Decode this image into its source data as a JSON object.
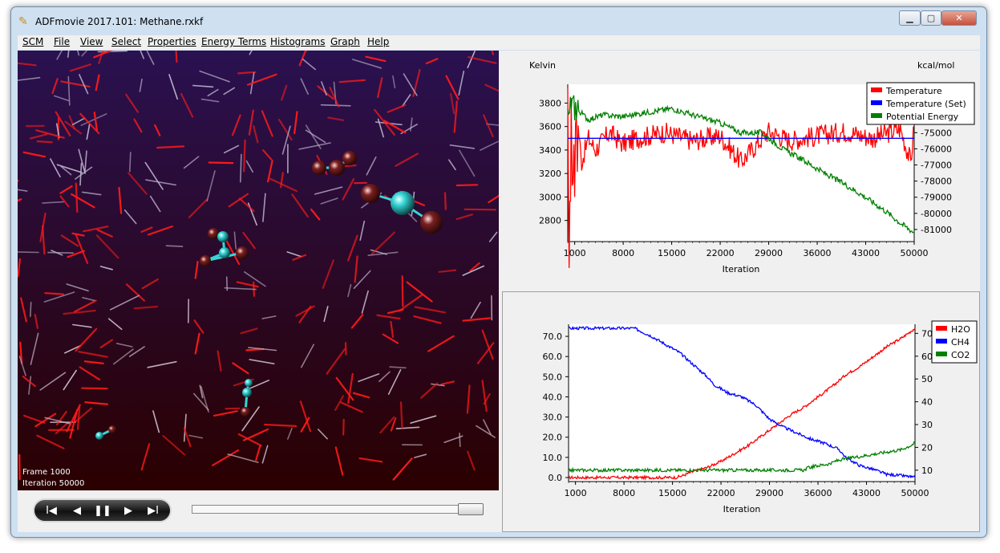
{
  "window": {
    "title": "ADFmovie 2017.101: Methane.rxkf",
    "minimize_label": "▁",
    "maximize_label": "▢",
    "close_label": "✕"
  },
  "menu": [
    "SCM",
    "File",
    "View",
    "Select",
    "Properties",
    "Energy Terms",
    "Histograms",
    "Graph",
    "Help"
  ],
  "viewer": {
    "frame_label": "Frame 1000",
    "iteration_label": "Iteration 50000",
    "playback_fraction": 0.98
  },
  "controls": {
    "first": "I◀",
    "prev": "◀",
    "pause": "❚❚",
    "next": "▶",
    "last": "▶I"
  },
  "colors": {
    "red": "#ff0000",
    "blue": "#0000ff",
    "green": "#008000",
    "viewer_top": "#2a1150",
    "viewer_bottom": "#2a0000",
    "carbon": "#35d5d5"
  },
  "chart_data": [
    {
      "type": "line",
      "left_unit": "Kelvin",
      "right_unit": "kcal/mol",
      "xlabel": "Iteration",
      "x_ticks": [
        1000,
        8000,
        15000,
        22000,
        29000,
        36000,
        43000,
        50000
      ],
      "xlim": [
        0,
        50000
      ],
      "y_left_ticks": [
        2800,
        3000,
        3200,
        3400,
        3600,
        3800
      ],
      "y_left_lim": [
        2620,
        3960
      ],
      "y_right_ticks": [
        -74000,
        -75000,
        -76000,
        -77000,
        -78000,
        -79000,
        -80000,
        -81000
      ],
      "y_right_lim": [
        -81750,
        -72000
      ],
      "legend": "top-right",
      "series": [
        {
          "name": "Temperature",
          "color": "#ff0000",
          "axis": "left",
          "x": [
            0,
            200,
            500,
            1000,
            1500,
            2000,
            3000,
            4000,
            6000,
            8000,
            10000,
            14000,
            18000,
            22000,
            25000,
            29000,
            32000,
            36000,
            40000,
            44000,
            48000,
            49500,
            50000
          ],
          "y": [
            3550,
            2720,
            3450,
            3180,
            3600,
            3300,
            3500,
            3400,
            3550,
            3450,
            3500,
            3550,
            3480,
            3520,
            3300,
            3560,
            3480,
            3520,
            3560,
            3500,
            3580,
            3300,
            3600
          ]
        },
        {
          "name": "Temperature (Set)",
          "color": "#0000ff",
          "axis": "left",
          "x": [
            0,
            50000
          ],
          "y": [
            3500,
            3500
          ]
        },
        {
          "name": "Potential Energy",
          "color": "#008000",
          "axis": "right",
          "x": [
            0,
            1000,
            3000,
            5000,
            8000,
            12000,
            15000,
            18000,
            22000,
            25000,
            28000,
            31000,
            34000,
            37000,
            40000,
            43000,
            46000,
            48000,
            50000
          ],
          "y": [
            -73000,
            -73400,
            -74200,
            -73900,
            -74000,
            -73700,
            -73500,
            -73900,
            -74400,
            -75000,
            -75000,
            -76000,
            -76700,
            -77500,
            -78200,
            -79000,
            -79900,
            -80600,
            -81200
          ]
        }
      ]
    },
    {
      "type": "line",
      "xlabel": "Iteration",
      "x_ticks": [
        1000,
        8000,
        15000,
        22000,
        29000,
        36000,
        43000,
        50000
      ],
      "xlim": [
        0,
        50000
      ],
      "y_left_ticks": [
        "0.0",
        "10.0",
        "20.0",
        "30.0",
        "40.0",
        "50.0",
        "60.0",
        "70.0"
      ],
      "y_left_lim": [
        -2,
        76
      ],
      "y_right_ticks": [
        10,
        20,
        30,
        40,
        50,
        60,
        70
      ],
      "y_right_lim": [
        5,
        74
      ],
      "legend": "top-right",
      "series": [
        {
          "name": "H2O",
          "color": "#ff0000",
          "axis": "left",
          "x": [
            0,
            15500,
            16500,
            18000,
            20000,
            22000,
            24000,
            26000,
            28000,
            30000,
            32000,
            34000,
            36000,
            38000,
            40000,
            42000,
            44000,
            46000,
            48000,
            50000
          ],
          "y": [
            0,
            0,
            1,
            3,
            5,
            8,
            12,
            16,
            21,
            26,
            31,
            35,
            40,
            45,
            51,
            55,
            60,
            65,
            69,
            74
          ]
        },
        {
          "name": "CH4",
          "color": "#0000ff",
          "axis": "left",
          "x": [
            0,
            9500,
            12000,
            14000,
            16000,
            18000,
            20000,
            21000,
            23000,
            25000,
            27000,
            29000,
            31000,
            33000,
            35000,
            37000,
            39000,
            40000,
            42000,
            44000,
            46000,
            48000,
            50000
          ],
          "y": [
            74,
            74,
            70,
            66,
            62,
            56,
            50,
            46,
            42,
            40,
            36,
            29,
            25,
            22,
            19,
            17,
            14,
            10,
            6,
            4,
            1.5,
            1,
            0
          ]
        },
        {
          "name": "CO2",
          "color": "#008000",
          "axis": "right",
          "x": [
            0,
            34000,
            34500,
            36000,
            38000,
            38500,
            40000,
            42000,
            44000,
            46000,
            48000,
            49500,
            50000
          ],
          "y": [
            10,
            10,
            11,
            12,
            13,
            14,
            15,
            16,
            17,
            18,
            19,
            21,
            22
          ]
        }
      ]
    }
  ]
}
